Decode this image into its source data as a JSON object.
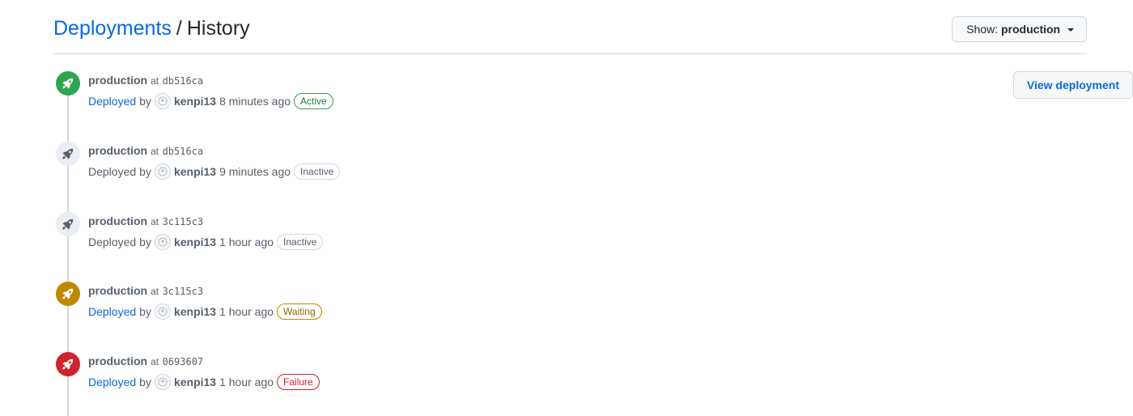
{
  "header": {
    "breadcrumb_link": "Deployments",
    "separator": "/",
    "title": "History",
    "show_label": "Show:",
    "show_value": "production"
  },
  "view_button": "View deployment",
  "entries": [
    {
      "environment": "production",
      "at": "at",
      "sha": "db516ca",
      "deployed": "Deployed",
      "deployed_is_link": true,
      "by": "by",
      "user": "kenpi13",
      "time": "8 minutes ago",
      "status": "Active",
      "state": "success",
      "icon": "rocket-icon"
    },
    {
      "environment": "production",
      "at": "at",
      "sha": "db516ca",
      "deployed": "Deployed",
      "deployed_is_link": false,
      "by": "by",
      "user": "kenpi13",
      "time": "9 minutes ago",
      "status": "Inactive",
      "state": "inactive",
      "icon": "rocket-icon"
    },
    {
      "environment": "production",
      "at": "at",
      "sha": "3c115c3",
      "deployed": "Deployed",
      "deployed_is_link": false,
      "by": "by",
      "user": "kenpi13",
      "time": "1 hour ago",
      "status": "Inactive",
      "state": "inactive",
      "icon": "rocket-icon"
    },
    {
      "environment": "production",
      "at": "at",
      "sha": "3c115c3",
      "deployed": "Deployed",
      "deployed_is_link": true,
      "by": "by",
      "user": "kenpi13",
      "time": "1 hour ago",
      "status": "Waiting",
      "state": "waiting",
      "icon": "rocket-icon"
    },
    {
      "environment": "production",
      "at": "at",
      "sha": "0693607",
      "deployed": "Deployed",
      "deployed_is_link": true,
      "by": "by",
      "user": "kenpi13",
      "time": "1 hour ago",
      "status": "Failure",
      "state": "failure",
      "icon": "rocket-icon"
    }
  ],
  "colors": {
    "success": {
      "icon_bg": "#2da44e",
      "icon_fg": "#ffffff",
      "label_fg": "#1a7f37",
      "label_border": "#2da44e"
    },
    "inactive": {
      "icon_bg": "#eaeef2",
      "icon_fg": "#57606a",
      "label_fg": "#57606a",
      "label_border": "#d0d7de"
    },
    "waiting": {
      "icon_bg": "#bf8700",
      "icon_fg": "#ffffff",
      "label_fg": "#9a6700",
      "label_border": "#bf8700"
    },
    "failure": {
      "icon_bg": "#cf222e",
      "icon_fg": "#ffffff",
      "label_fg": "#cf222e",
      "label_border": "#cf222e"
    },
    "link": "#0969da"
  }
}
